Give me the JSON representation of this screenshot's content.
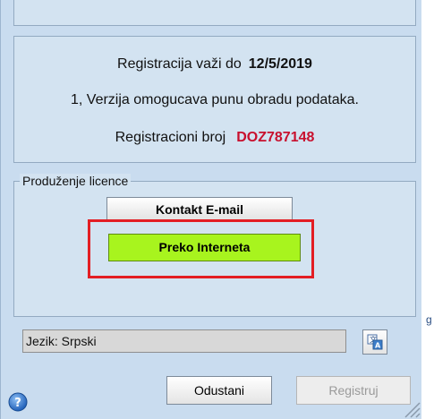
{
  "info": {
    "reg_label": "Registracija važi do",
    "reg_date": "12/5/2019",
    "version_text": "1, Verzija omogucava punu obradu podataka.",
    "reg_number_label": "Registracioni broj",
    "reg_number": "DOZ787148"
  },
  "license": {
    "legend": "Produženje licence",
    "email_button": "Kontakt E-mail",
    "internet_button": "Preko Interneta"
  },
  "language": {
    "value": "Jezik: Srpski",
    "translate_icon": "translate-icon"
  },
  "footer": {
    "cancel_label": "Odustani",
    "register_label": "Registruj",
    "help_icon": "help-icon"
  },
  "background": {
    "edge_fragment": "g"
  },
  "colors": {
    "window_bg": "#c9dcef",
    "panel_bg": "#d3e3f1",
    "reg_number": "#c8102e",
    "internet_button": "#a8f41e",
    "highlight": "#e31e24"
  }
}
